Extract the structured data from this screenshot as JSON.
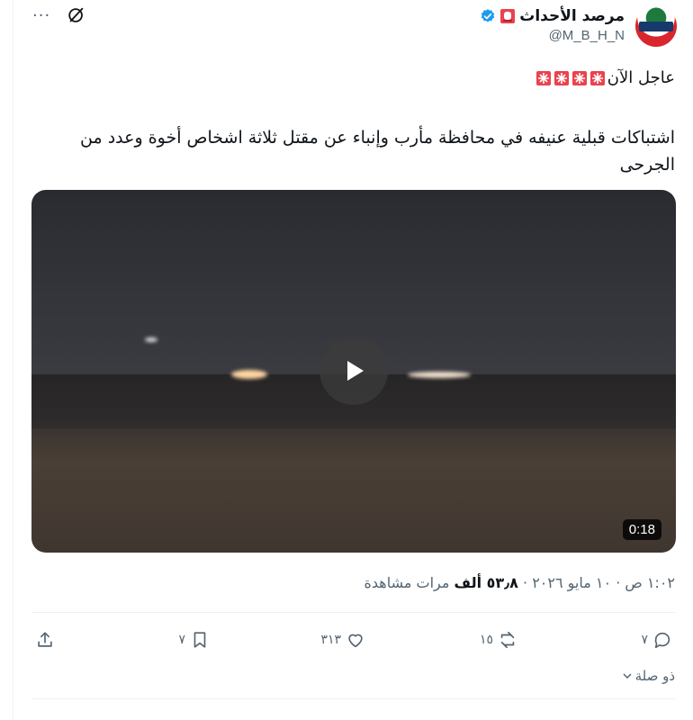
{
  "author": {
    "display_name": "مرصد الأحداث",
    "handle": "@M_B_H_N",
    "avatar_text": "مرصد الأحداث"
  },
  "post": {
    "breaking_label": "عاجل الآن",
    "body": "اشتباكات قبلية عنيفه في محافظة مأرب وإنباء عن مقتل ثلاثة اشخاص أخوة وعدد من الجرحى"
  },
  "video": {
    "duration": "0:18"
  },
  "meta": {
    "time": "١:٠٢ ص",
    "date": "١٠ مايو ٢٠٢٦",
    "views_count": "٥٣٫٨ ألف",
    "views_label": "مرات مشاهدة",
    "separator": "·"
  },
  "actions": {
    "replies": "٧",
    "reposts": "١٥",
    "likes": "٣١٣",
    "bookmarks": "٧"
  },
  "thread_label": "ذو صلة",
  "colors": {
    "verified": "#1d9bf0",
    "secondary_text": "#536471",
    "siren": "#e8434f"
  }
}
